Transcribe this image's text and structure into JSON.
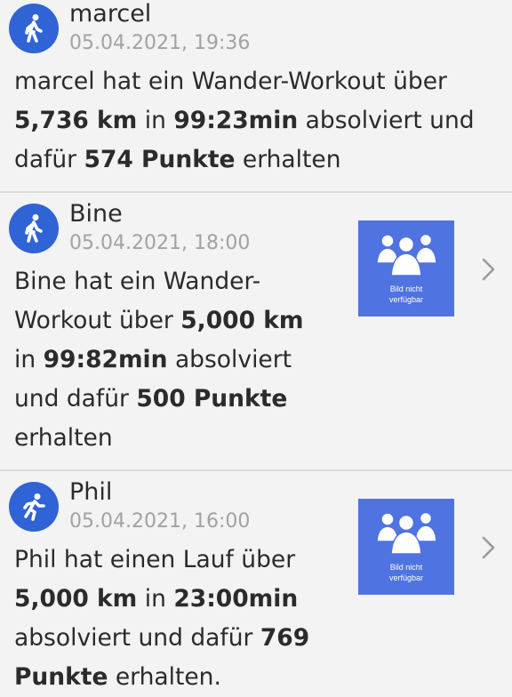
{
  "items": [
    {
      "name": "marcel",
      "date": "05.04.2021, 19:36",
      "activity_icon": "walk-icon",
      "t1": "marcel hat ein Wander-Workout über",
      "b1": "5,736 km",
      "t2": " in ",
      "b2": "99:23min",
      "t3": " absolviert und",
      "t4": "dafür ",
      "b3": "574 Punkte",
      "t5": " erhalten",
      "has_image": false
    },
    {
      "name": "Bine",
      "date": "05.04.2021, 18:00",
      "activity_icon": "walk-icon",
      "t1": "Bine hat ein Wander-",
      "t2": "Workout über ",
      "b1": "5,000 km",
      "t3": "in ",
      "b2": "99:82min",
      "t4": " absolviert",
      "t5": "und dafür ",
      "b3": "500 Punkte",
      "t6": "erhalten",
      "has_image": true,
      "image_caption_line1": "Bild nicht",
      "image_caption_line2": "verfügbar"
    },
    {
      "name": "Phil",
      "date": "05.04.2021, 16:00",
      "activity_icon": "run-icon",
      "t1": "Phil hat einen Lauf über",
      "b1": "5,000 km",
      "t2": " in ",
      "b2": "23:00min",
      "t3": "absolviert und dafür ",
      "b3": "769",
      "b4": "Punkte",
      "t4": " erhalten.",
      "has_image": true,
      "image_caption_line1": "Bild nicht",
      "image_caption_line2": "verfügbar"
    }
  ],
  "colors": {
    "avatar": "#2f63d6",
    "thumbnail": "#4f73e0",
    "date_text": "#a2a2a2",
    "divider": "#dcdcdc",
    "background": "#f3f3f3"
  }
}
